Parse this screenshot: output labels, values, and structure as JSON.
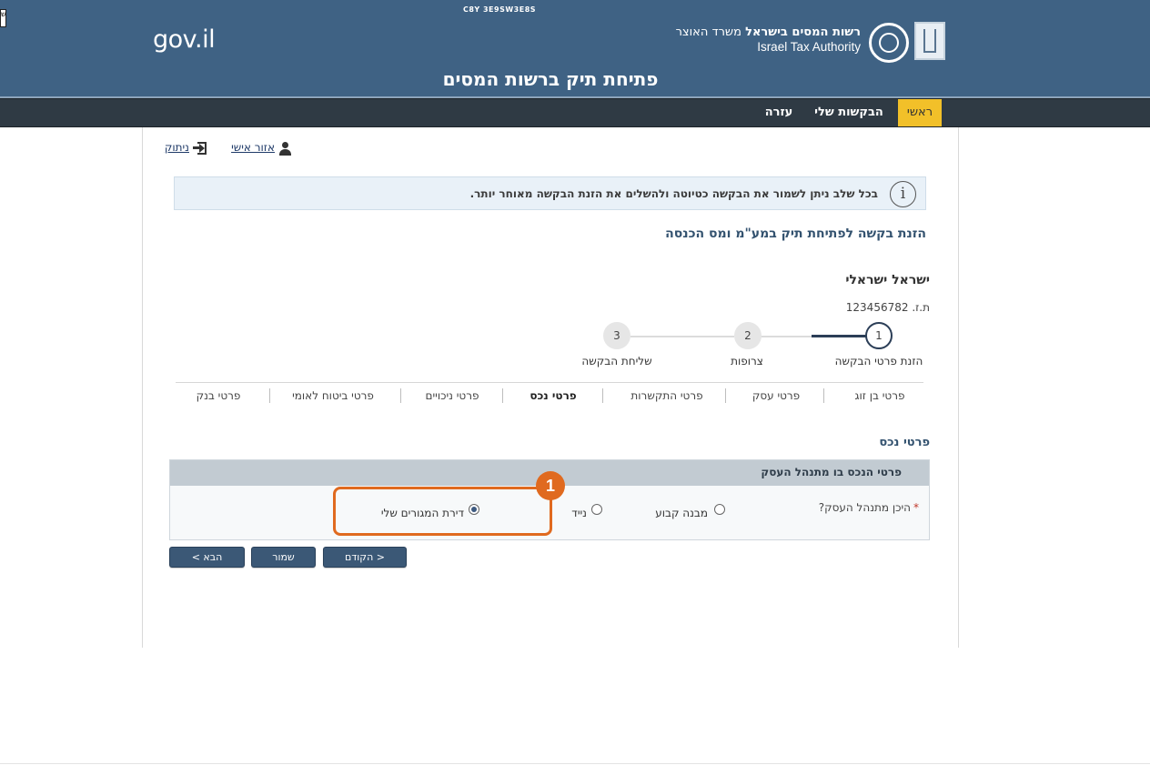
{
  "header": {
    "small_code": "C8Y 3E9SW3E8S",
    "gov_logo": "gov.il",
    "authority_hebrew_bold": "רשות המסים בישראל",
    "authority_hebrew_ministry": "משרד האוצר",
    "authority_english": "Israel Tax Authority",
    "page_title": "פתיחת תיק ברשות המסים",
    "corner_text": "ש"
  },
  "nav": {
    "home": "ראשי",
    "my_requests": "הבקשות שלי",
    "help": "עזרה"
  },
  "user": {
    "name": "אזור אישי",
    "logout": "ניתוק"
  },
  "info_message": "בכל שלב ניתן לשמור את הבקשה כטיוטה ולהשלים את הזנת הבקשה מאוחר יותר.",
  "request_title": "הזנת בקשה לפתיחת תיק במע\"מ ומס הכנסה",
  "person": {
    "name": "ישראל ישראלי",
    "id_label": "ת.ז.",
    "id_value": "123456782"
  },
  "steps": [
    {
      "number": "1",
      "label": "הזנת פרטי הבקשה",
      "state": "current"
    },
    {
      "number": "2",
      "label": "צרופות",
      "state": "pending"
    },
    {
      "number": "3",
      "label": "שליחת הבקשה",
      "state": "pending"
    }
  ],
  "tabs": [
    {
      "label": "פרטי בן זוג",
      "active": false
    },
    {
      "label": "פרטי עסק",
      "active": false
    },
    {
      "label": "פרטי התקשרות",
      "active": false
    },
    {
      "label": "פרטי נכס",
      "active": true
    },
    {
      "label": "פרטי ניכויים",
      "active": false
    },
    {
      "label": "פרטי ביטוח לאומי",
      "active": false
    },
    {
      "label": "פרטי בנק",
      "active": false
    }
  ],
  "section_title": "פרטי נכס",
  "panel": {
    "header": "פרטי הנכס בו מתנהל העסק",
    "question": "היכן מתנהל העסק?",
    "required_mark": "*",
    "options": [
      {
        "label": "מבנה קבוע",
        "selected": false
      },
      {
        "label": "נייד",
        "selected": false
      },
      {
        "label": "דירת המגורים שלי",
        "selected": true
      }
    ]
  },
  "annotation_badge": "1",
  "buttons": {
    "previous": "< הקודם",
    "save": "שמור",
    "next": "הבא >"
  },
  "colors": {
    "header_bg": "#3f6284",
    "nav_bg": "#2f3a44",
    "nav_active": "#f2c029",
    "button_bg": "#3b5876",
    "highlight": "#e06a1f"
  }
}
